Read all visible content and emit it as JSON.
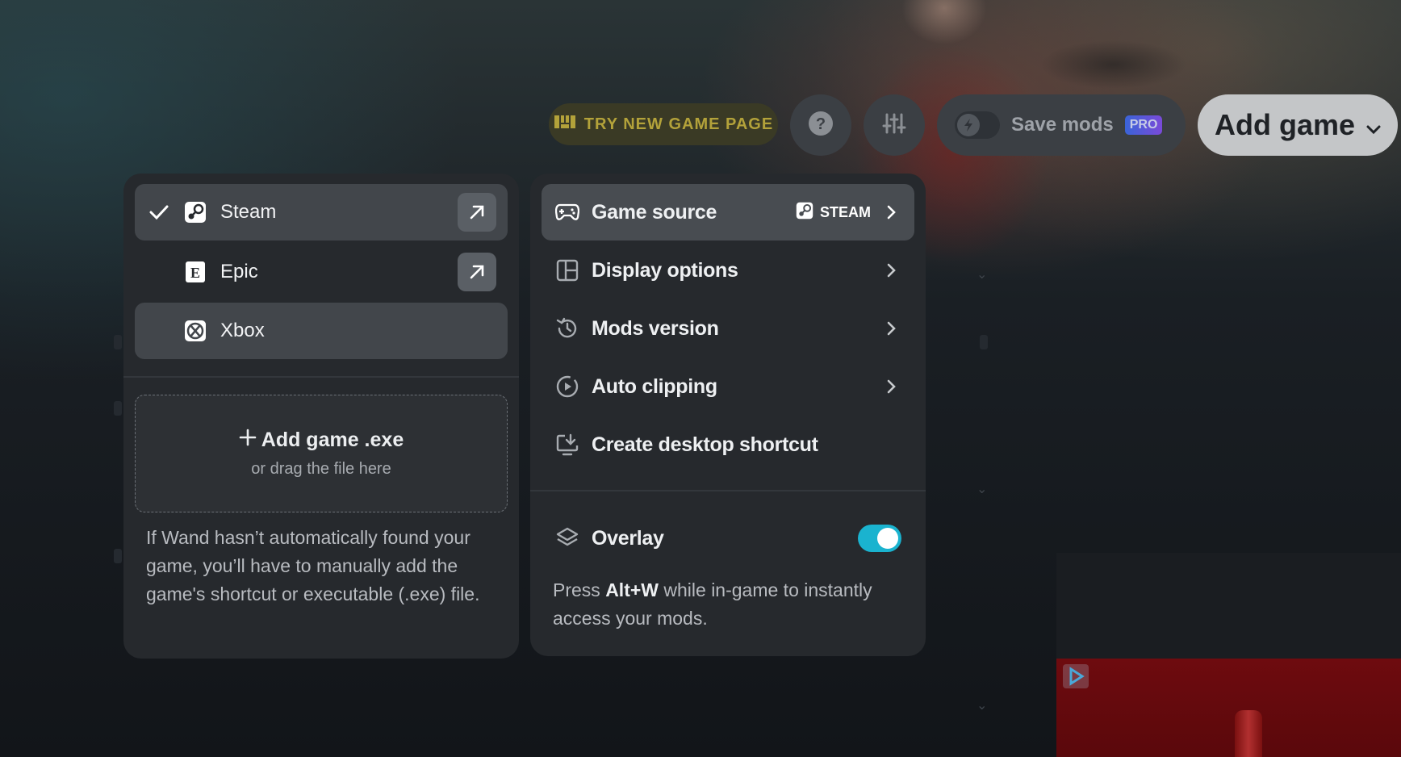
{
  "topbar": {
    "try_label": "TRY NEW GAME PAGE",
    "save_label": "Save mods",
    "pro_badge": "PRO",
    "add_game_label": "Add game"
  },
  "platforms": [
    {
      "label": "Steam",
      "selected": true,
      "checked": true,
      "icon": "steam-icon",
      "external": true
    },
    {
      "label": "Epic",
      "selected": false,
      "checked": false,
      "icon": "epic-icon",
      "external": true
    },
    {
      "label": "Xbox",
      "selected": true,
      "checked": false,
      "icon": "xbox-icon",
      "external": false
    }
  ],
  "dropzone": {
    "title": "Add game .exe",
    "subtitle": "or drag the file here"
  },
  "help_text": "If Wand hasn’t automatically found your game, you’ll have to manually add the game's shortcut or executable (.exe) file.",
  "menu": {
    "game_source": {
      "label": "Game source",
      "value": "STEAM"
    },
    "display_options": {
      "label": "Display options"
    },
    "mods_version": {
      "label": "Mods version"
    },
    "auto_clipping": {
      "label": "Auto clipping"
    },
    "desktop_shortcut": {
      "label": "Create desktop shortcut"
    }
  },
  "overlay": {
    "label": "Overlay",
    "enabled": true,
    "desc_before": "Press ",
    "desc_key": "Alt+W",
    "desc_after": " while in-game to instantly access your mods."
  },
  "colors": {
    "accent_toggle": "#1ab3cf",
    "try_text": "#b3a23a",
    "pro_badge": "#5a56d8"
  }
}
